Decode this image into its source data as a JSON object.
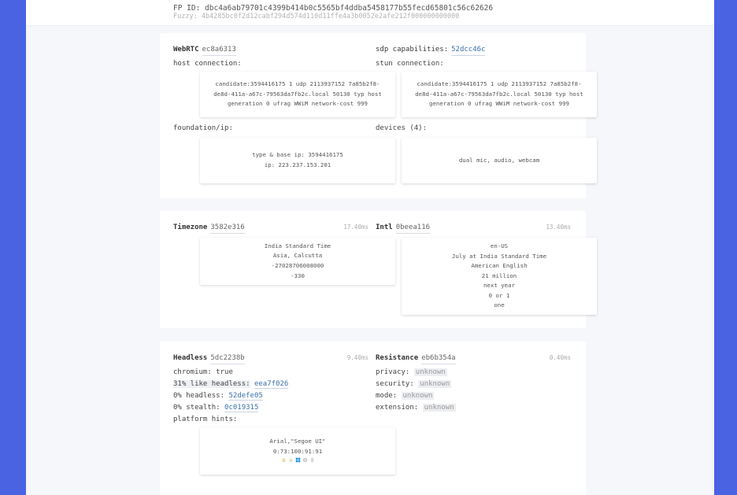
{
  "header": {
    "fp_id": "FP ID: dbc4a6ab79701c4399b414b0c5565bf4ddba5458177b55fecd65801c56c62626",
    "fuzzy": "Fuzzy: 4b4285bc0f2d12cabf294d574d110d11ffe4a3b0052e2afe212f000000000000"
  },
  "webrtc": {
    "title": "WebRTC",
    "hash": "ec8a6313",
    "host_label": "host connection:",
    "host_candidate": [
      "candidate:3594416175 1 udp 2113937152 7a85b2f8-",
      "de8d-411a-a67c-79563da7fb2c.local 50130 typ host",
      "generation 0 ufrag WWiM network-cost 999"
    ],
    "foundation_label": "foundation/ip:",
    "foundation": [
      "type & base ip: 3594416175",
      "ip: 223.237.153.201"
    ],
    "sdp_label": "sdp capabilities:",
    "sdp_hash": "52dcc46c",
    "stun_label": "stun connection:",
    "stun_candidate": [
      "candidate:3594416175 1 udp 2113937152 7a85b2f8-",
      "de8d-411a-a67c-79563da7fb2c.local 50130 typ host",
      "generation 0 ufrag WWiM network-cost 999"
    ],
    "devices_label": "devices (4):",
    "devices": "dual mic, audio, webcam"
  },
  "timezone": {
    "title": "Timezone",
    "hash": "3582e316",
    "time": "17.40ms",
    "lines": [
      "India Standard Time",
      "Asia, Calcutta",
      "-27028706008000",
      "-330"
    ]
  },
  "intl": {
    "title": "Intl",
    "hash": "0beea116",
    "time": "13.40ms",
    "lines": [
      "en-US",
      "July at India Standard Time",
      "American English",
      "21 million",
      "next year",
      "0 or 1",
      "one"
    ]
  },
  "headless": {
    "title": "Headless",
    "hash": "5dc2238b",
    "time": "9.40ms",
    "chromium": "chromium: true",
    "like_headless": "31% like headless:",
    "like_headless_hash": "eea7f026",
    "headless": "0% headless:",
    "headless_hash": "52defe05",
    "stealth": "0% stealth:",
    "stealth_hash": "0c019315",
    "platform_label": "platform hints:",
    "platform_lines": [
      "Arial,\"Segoe UI\"",
      "0:73:100:91:91"
    ],
    "platform_icons": [
      "android-icon",
      "apple-icon",
      "windows-icon",
      "chrome-os-icon",
      "linux-icon"
    ],
    "windows_color": "#1e90e6"
  },
  "resistance": {
    "title": "Resistance",
    "hash": "eb6b354a",
    "time": "0.40ms",
    "privacy": "privacy:",
    "security": "security:",
    "mode": "mode:",
    "extension": "extension:",
    "unknown": "unknown"
  }
}
